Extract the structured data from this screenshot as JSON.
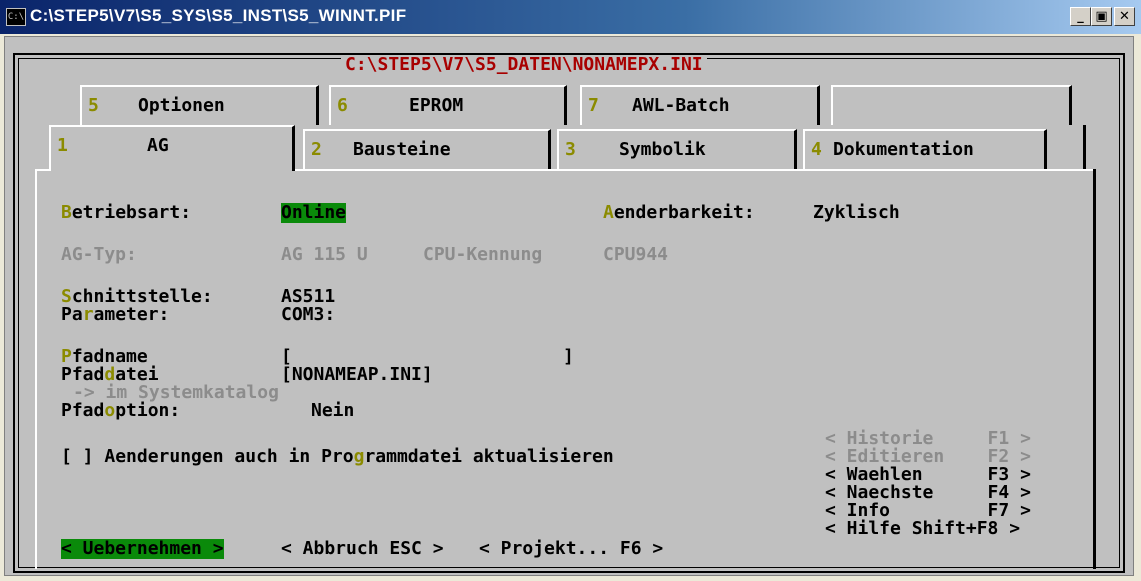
{
  "window": {
    "title": "C:\\STEP5\\V7\\S5_SYS\\S5_INST\\S5_WINNT.PIF",
    "icon": "dos-console-icon",
    "buttons": {
      "minimize": "_",
      "maximize": "▣",
      "close": "✕"
    }
  },
  "dialog": {
    "frame_title": "C:\\STEP5\\V7\\S5_DATEN\\NONAMEPX.INI",
    "tabs_back": [
      {
        "num": "5",
        "label": "Optionen"
      },
      {
        "num": "6",
        "label": "EPROM"
      },
      {
        "num": "7",
        "label": "AWL-Batch"
      }
    ],
    "tabs_front": [
      {
        "num": "1",
        "label": "AG"
      },
      {
        "num": "2",
        "label": "Bausteine"
      },
      {
        "num": "3",
        "label": "Symbolik"
      },
      {
        "num": "4",
        "label": "Dokumentation"
      }
    ],
    "active_tab": "1"
  },
  "form": {
    "betriebsart": {
      "hot": "B",
      "rest": "etriebsart:",
      "value": "Online"
    },
    "aenderbarkeit": {
      "hot": "A",
      "rest": "enderbarkeit:",
      "value": "Zyklisch"
    },
    "ag_typ": {
      "label": "AG-Typ:",
      "value": "AG 115 U",
      "cpu_label": "CPU-Kennung",
      "cpu_value": "CPU944"
    },
    "schnittstelle": {
      "hot": "S",
      "rest": "chnittstelle:",
      "value": "AS511"
    },
    "parameter": {
      "pre": "Pa",
      "hot": "r",
      "rest": "ameter:",
      "value": "COM3:"
    },
    "pfadname": {
      "hot": "P",
      "rest": "fadname",
      "open": "[",
      "close": "]"
    },
    "pfaddatei": {
      "pre": "Pfad",
      "hot": "d",
      "rest": "atei",
      "value": "[NONAMEAP.INI]"
    },
    "systemkatalog": "-> im Systemkatalog",
    "pfadoption": {
      "pre": "Pfad",
      "hot": "o",
      "rest": "ption:",
      "value": "Nein"
    },
    "checkbox": {
      "box": "[ ]",
      "pre": "Aenderungen auch in Pro",
      "hot": "g",
      "rest": "rammdatei aktualisieren"
    }
  },
  "fkeys": [
    {
      "label": "< Historie     F1 >",
      "enabled": false
    },
    {
      "label": "< Editieren    F2 >",
      "enabled": false
    },
    {
      "label": "< Waehlen      F3 >",
      "enabled": true
    },
    {
      "label": "< Naechste     F4 >",
      "enabled": true
    },
    {
      "label": "< Info         F7 >",
      "enabled": true
    },
    {
      "label": "< Hilfe Shift+F8 >",
      "enabled": true
    }
  ],
  "buttons": {
    "uebernehmen": "< Uebernehmen >",
    "abbruch": "< Abbruch ESC >",
    "projekt": "< Projekt... F6 >"
  },
  "colors": {
    "background": "#c0c0c0",
    "highlight_green": "#0a8a0a",
    "hotkey": "#8b8b00",
    "title_red": "#a80000",
    "disabled": "#8c8c8c"
  }
}
